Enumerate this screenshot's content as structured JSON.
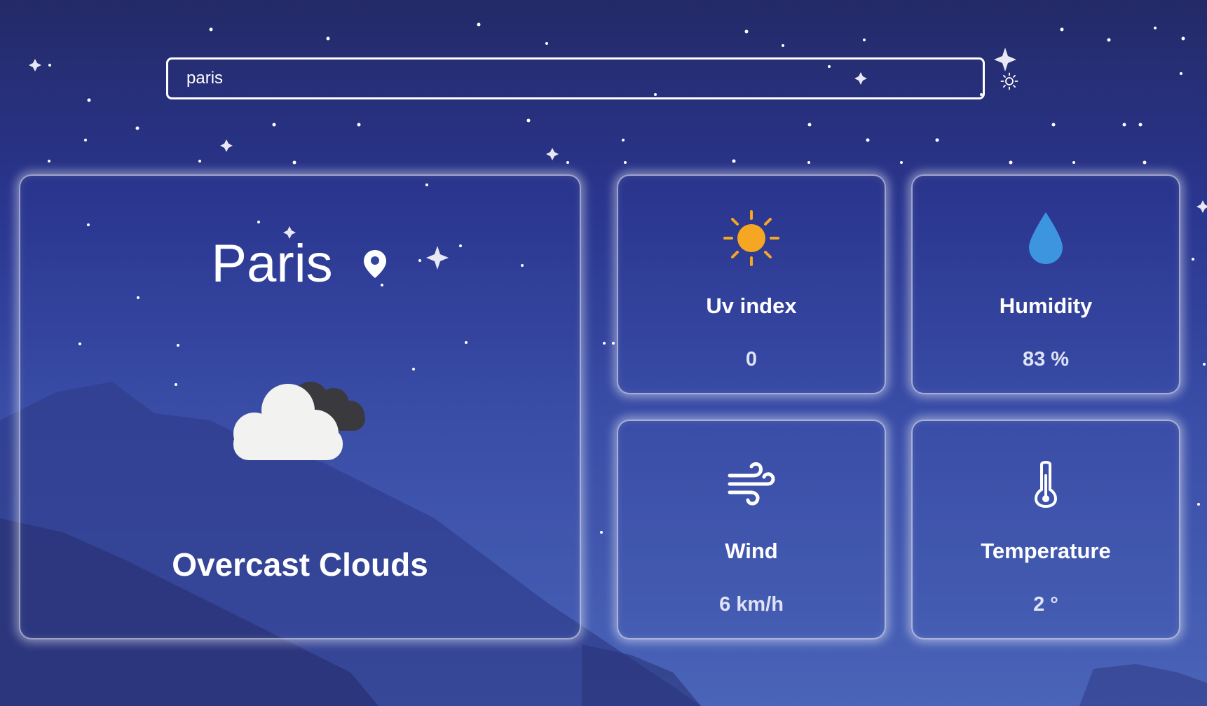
{
  "search": {
    "value": "paris",
    "placeholder": ""
  },
  "location": {
    "city": "Paris",
    "condition": "Overcast Clouds",
    "condition_icon": "overcast-clouds-icon"
  },
  "stats": {
    "uv": {
      "label": "Uv index",
      "value": "0",
      "icon": "sun-icon"
    },
    "humidity": {
      "label": "Humidity",
      "value": "83 %",
      "icon": "water-drop-icon"
    },
    "wind": {
      "label": "Wind",
      "value": "6 km/h",
      "icon": "wind-icon"
    },
    "temperature": {
      "label": "Temperature",
      "value": "2 °",
      "icon": "thermometer-icon"
    }
  },
  "colors": {
    "background": "#2a3690",
    "sun": "#f5a623",
    "drop": "#3d95e0",
    "text": "#ffffff"
  }
}
